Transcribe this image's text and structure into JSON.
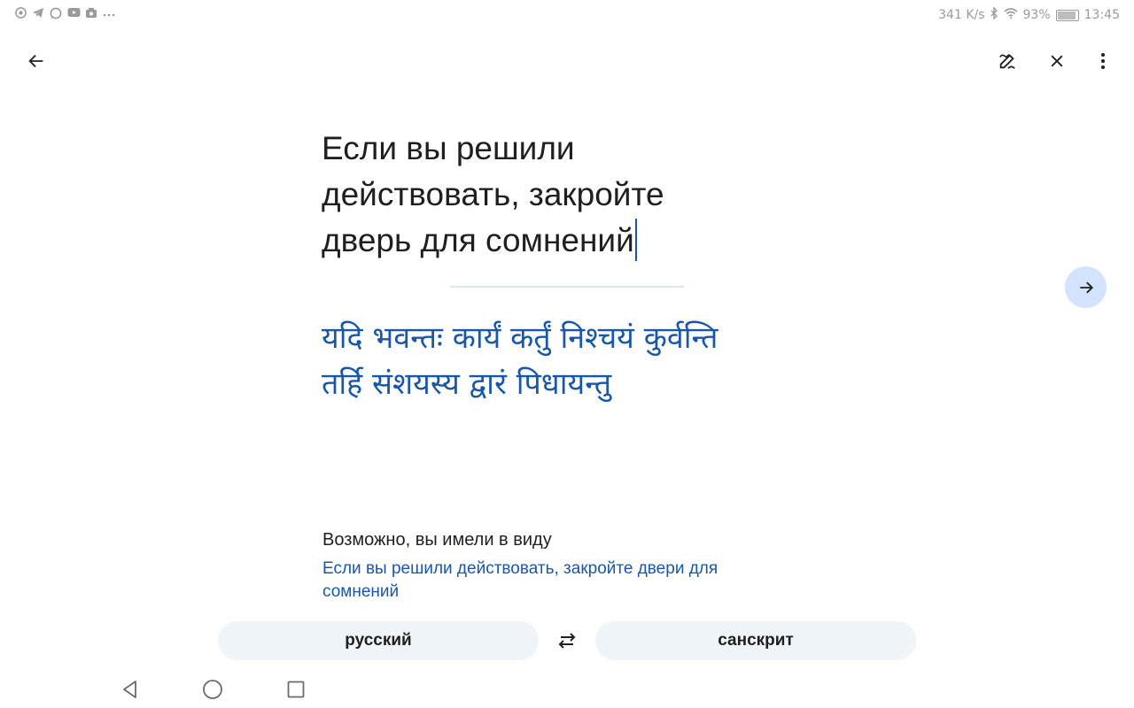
{
  "status_bar": {
    "speed": "341 K/s",
    "battery": "93%",
    "time": "13:45",
    "left_icons": [
      "chrome-icon",
      "telegram-icon",
      "whatsapp-icon",
      "youtube-icon",
      "photos-icon",
      "more-notifications-icon"
    ],
    "right_icons": [
      "bluetooth-icon",
      "wifi-icon",
      "battery-icon"
    ]
  },
  "toolbar": {
    "back_icon": "arrow-back-icon",
    "handwriting_icon": "handwriting-icon",
    "close_icon": "close-icon",
    "more_icon": "more-vert-icon"
  },
  "source": {
    "lines": [
      "Если вы решили",
      "действовать, закройте",
      "дверь для сомнений"
    ]
  },
  "translation": {
    "lines": [
      "यदि भवन्तः कार्यं कर्तुं निश्चयं कुर्वन्ति",
      "तर्हि संशयस्य द्वारं पिधायन्तु"
    ]
  },
  "suggestion": {
    "title": "Возможно, вы имели в виду",
    "text": "Если вы решили действовать, закройте двери для сомнений"
  },
  "languages": {
    "source": "русский",
    "target": "санскрит",
    "swap_icon": "swap-icon"
  },
  "colors": {
    "accent": "#1a57a7",
    "send_button_bg": "#d3e3fd",
    "pill_bg": "#eef4f7",
    "divider": "#d7e8ee"
  },
  "nav_bar": {
    "icons": [
      "nav-back-icon",
      "nav-home-icon",
      "nav-recents-icon"
    ]
  }
}
